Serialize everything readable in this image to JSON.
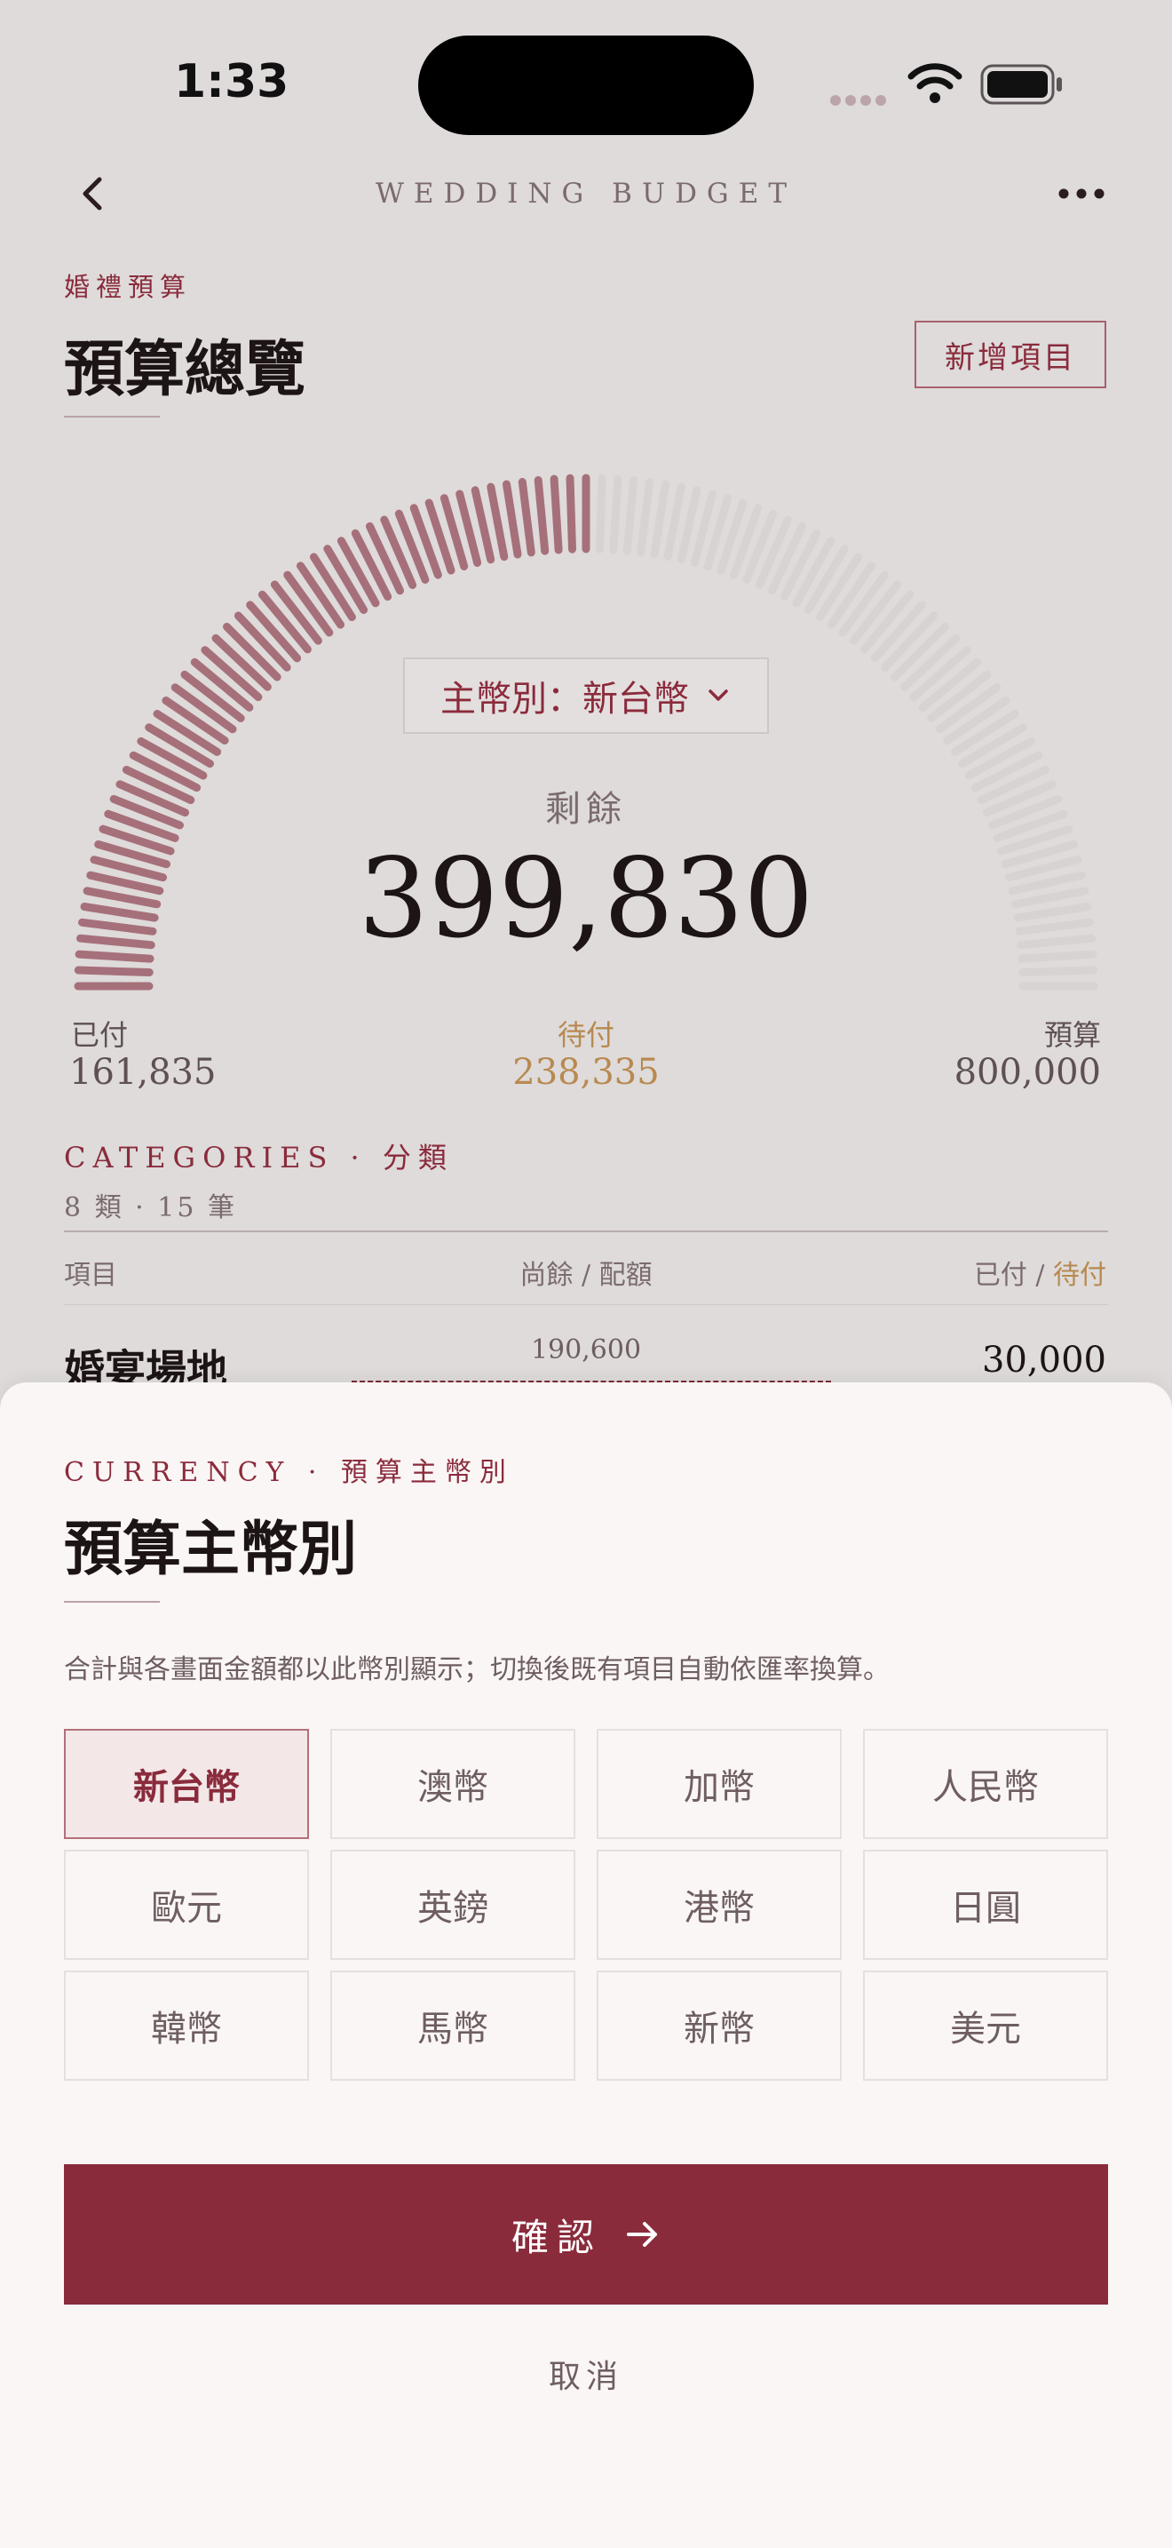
{
  "status_bar": {
    "time": "1:33"
  },
  "nav": {
    "title": "WEDDING BUDGET",
    "back_icon": "chevron-left-icon",
    "more_icon": "ellipsis-icon"
  },
  "header": {
    "eyebrow": "婚禮預算",
    "title": "預算總覽",
    "add_button": "新增項目"
  },
  "summary": {
    "currency_button": "主幣別：新台幣",
    "remaining_label": "剩餘",
    "remaining_value": "399,830",
    "paid_label": "已付",
    "paid_value": "161,835",
    "pending_label": "待付",
    "pending_value": "238,335",
    "budget_label": "預算",
    "budget_value": "800,000",
    "gauge_filled_fraction": 0.5,
    "colors": {
      "gauge_fill": "#a6707a",
      "gauge_empty": "#d8d3d3",
      "pending": "#b88950",
      "accent": "#8a2b3c"
    }
  },
  "categories": {
    "title": "CATEGORIES · 分類",
    "subtitle": "8 類 · 15 筆",
    "col_item": "項目",
    "col_remaining": "尚餘 / 配額",
    "col_paid": "已付",
    "col_sep": " / ",
    "col_pending": "待付",
    "rows": [
      {
        "name": "婚宴場地",
        "remaining": "190,600",
        "paid": "30,000"
      }
    ]
  },
  "sheet": {
    "eyebrow": "CURRENCY · 預算主幣別",
    "title": "預算主幣別",
    "description": "合計與各畫面金額都以此幣別顯示；切換後既有項目自動依匯率換算。",
    "options": [
      "新台幣",
      "澳幣",
      "加幣",
      "人民幣",
      "歐元",
      "英鎊",
      "港幣",
      "日圓",
      "韓幣",
      "馬幣",
      "新幣",
      "美元"
    ],
    "selected": "新台幣",
    "confirm": "確認",
    "cancel": "取消"
  }
}
